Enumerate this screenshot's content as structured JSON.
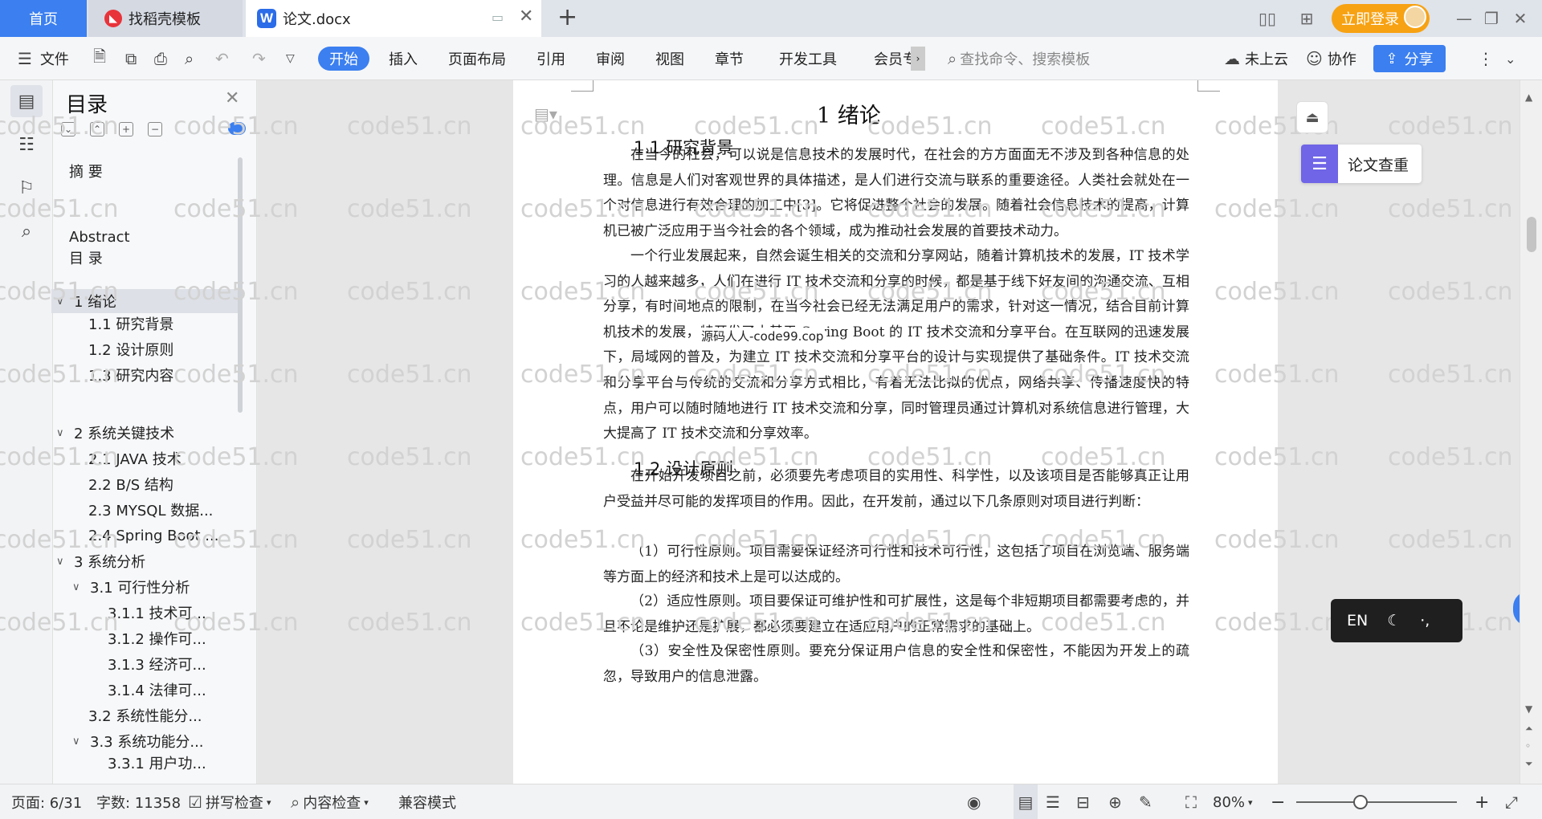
{
  "tabs": {
    "home": "首页",
    "daoke": "找稻壳模板",
    "doc": "论文.docx",
    "add": "+"
  },
  "titlebar": {
    "login": "立即登录"
  },
  "ribbon": {
    "file": "文件",
    "items": [
      "开始",
      "插入",
      "页面布局",
      "引用",
      "审阅",
      "视图",
      "章节",
      "开发工具",
      "会员专"
    ],
    "search_placeholder": "查找命令、搜索模板",
    "cloud": "未上云",
    "collab": "协作",
    "share": "分享"
  },
  "toc": {
    "title": "目录",
    "items": [
      {
        "label": "摘  要",
        "level": 1
      },
      {
        "label": "Abstract",
        "level": 1
      },
      {
        "label": "目  录",
        "level": 1
      },
      {
        "label": "1  绪论",
        "level": 1,
        "expanded": true,
        "selected": true
      },
      {
        "label": "1.1  研究背景",
        "level": 2
      },
      {
        "label": "1.2  设计原则",
        "level": 2
      },
      {
        "label": "1.3  研究内容",
        "level": 2
      },
      {
        "label": "2  系统关键技术",
        "level": 1,
        "expanded": true
      },
      {
        "label": "2.1 JAVA 技术",
        "level": 2
      },
      {
        "label": "2.2 B/S 结构",
        "level": 2
      },
      {
        "label": "2.3 MYSQL 数据...",
        "level": 2
      },
      {
        "label": "2.4 Spring Boot ...",
        "level": 2
      },
      {
        "label": "3  系统分析",
        "level": 1,
        "expanded": true
      },
      {
        "label": "3.1  可行性分析",
        "level": 2,
        "expanded": true
      },
      {
        "label": "3.1.1  技术可...",
        "level": 3
      },
      {
        "label": "3.1.2  操作可...",
        "level": 3
      },
      {
        "label": "3.1.3  经济可...",
        "level": 3
      },
      {
        "label": "3.1.4  法律可...",
        "level": 3
      },
      {
        "label": "3.2 系统性能分...",
        "level": 2
      },
      {
        "label": "3.3 系统功能分...",
        "level": 2,
        "expanded": true
      },
      {
        "label": "3.3.1 用户功...",
        "level": 3
      }
    ]
  },
  "document": {
    "heading1": "1  绪论",
    "h2_background": "1.1  研究背景",
    "para1": "在当今的社会，可以说是信息技术的发展时代，在社会的方方面面无不涉及到各种信息的处理。信息是人们对客观世界的具体描述，是人们进行交流与联系的重要途径。人类社会就处在一个对信息进行有效合理的加工中[3]。它将促进整个社会的发展。随着社会信息技术的提高，计算机已被广泛应用于当今社会的各个领域，成为推动社会发展的首要技术动力。",
    "para2": "一个行业发展起来，自然会诞生相关的交流和分享网站，随着计算机技术的发展，IT 技术学习的人越来越多，人们在进行 IT 技术交流和分享的时候，都是基于线下好友间的沟通交流、互相分享，有时间地点的限制，在当今社会已经无法满足用户的需求，针对这一情况，结合目前计算机技术的发展，特开发了本基于 Spring Boot 的 IT 技术交流和分享平台。在互联网的迅速发展下，局域网的普及，为建立 IT 技术交流和分享平台的设计与实现提供了基础条件。IT 技术交流和分享平台与传统的交流和分享方式相比，有着无法比拟的优点，网络共享、传播速度快的特点，用户可以随时随地进行 IT 技术交流和分享，同时管理员通过计算机对系统信息进行管理，大大提高了 IT 技术交流和分享效率。",
    "overlay_text": "源码人人-code99.cop",
    "h2_principles": "1.2  设计原则",
    "para3": "在开始开发项目之前，必须要先考虑项目的实用性、科学性，以及该项目是否能够真正让用户受益并尽可能的发挥项目的作用。因此，在开发前，通过以下几条原则对项目进行判断：",
    "para4": "（1）可行性原则。项目需要保证经济可行性和技术可行性，这包括了项目在浏览端、服务端等方面上的经济和技术上是可以达成的。",
    "para5": "（2）适应性原则。项目要保证可维护性和可扩展性，这是每个非短期项目都需要考虑的，并且不论是维护还是扩展，都必须要建立在适应用户的正常需求的基础上。",
    "para6": "（3）安全性及保密性原则。要充分保证用户信息的安全性和保密性，不能因为开发上的疏忽，导致用户的信息泄露。"
  },
  "watermark": "code51.cn",
  "right_panel": {
    "plagiarism": "论文查重",
    "lang": "EN"
  },
  "statusbar": {
    "page": "页面: 6/31",
    "words": "字数: 11358",
    "spellcheck": "拼写检查",
    "contentcheck": "内容检查",
    "compat": "兼容模式",
    "zoom": "80%",
    "zoom_level": 0.4
  },
  "colors": {
    "accent": "#3b7ff0",
    "login": "#f7a213",
    "plagiarism_icon": "#6f65e6"
  }
}
